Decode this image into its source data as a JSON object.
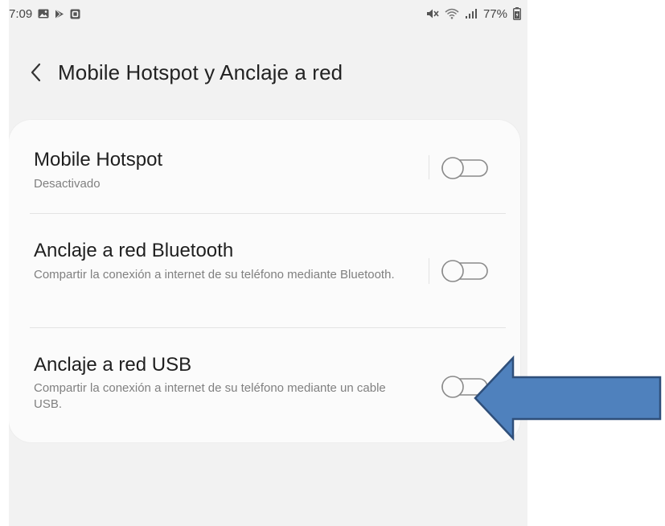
{
  "status_bar": {
    "time": "7:09",
    "battery_percent": "77%",
    "left_icons": [
      "gallery-icon",
      "play-store-icon",
      "square-app-icon"
    ],
    "right_icons": [
      "mute-icon",
      "wifi-icon",
      "signal-icon",
      "battery-icon"
    ]
  },
  "header": {
    "back_icon": "chevron-left-icon",
    "title": "Mobile Hotspot y Anclaje a red"
  },
  "settings": {
    "items": [
      {
        "title": "Mobile Hotspot",
        "subtitle": "Desactivado",
        "enabled": false
      },
      {
        "title": "Anclaje a red Bluetooth",
        "subtitle": "Compartir la conexión a internet de su teléfono mediante Bluetooth.",
        "enabled": false
      },
      {
        "title": "Anclaje a red USB",
        "subtitle": "Compartir la conexión a internet de su teléfono mediante un cable USB.",
        "enabled": false
      }
    ]
  },
  "colors": {
    "screen_bg": "#f2f2f2",
    "card_bg": "#fbfbfb",
    "title_text": "#1f1f1f",
    "subtitle_text": "#808080",
    "toggle_outline": "#8a8a8a",
    "arrow_fill": "#4f81bd",
    "arrow_stroke": "#2f4f7a"
  },
  "annotation": {
    "shape": "arrow-left",
    "points_to": "Anclaje a red USB toggle"
  }
}
